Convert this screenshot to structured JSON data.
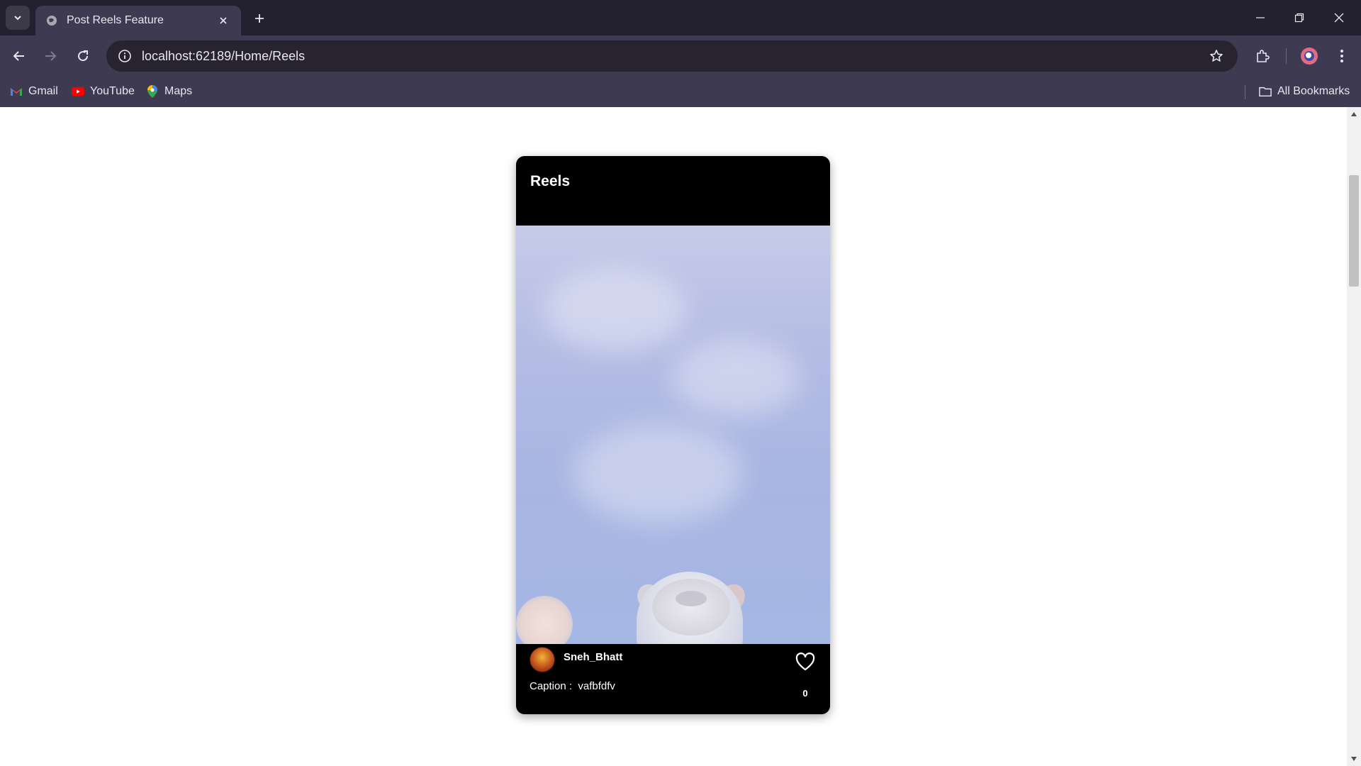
{
  "browser": {
    "tab": {
      "title": "Post Reels Feature"
    },
    "address_bar": {
      "url": "localhost:62189/Home/Reels"
    },
    "bookmarks": [
      {
        "label": "Gmail",
        "icon": "gmail-icon"
      },
      {
        "label": "YouTube",
        "icon": "youtube-icon"
      },
      {
        "label": "Maps",
        "icon": "maps-icon"
      }
    ],
    "all_bookmarks_label": "All Bookmarks"
  },
  "reel": {
    "header_title": "Reels",
    "username": "Sneh_Bhatt",
    "caption_label": "Caption :",
    "caption_text": "vafbfdfv",
    "like_count": "0"
  },
  "colors": {
    "chrome_dark": "#23202f",
    "chrome_toolbar": "#3e3a51",
    "card_background": "#000000",
    "page_background": "#ffffff"
  }
}
